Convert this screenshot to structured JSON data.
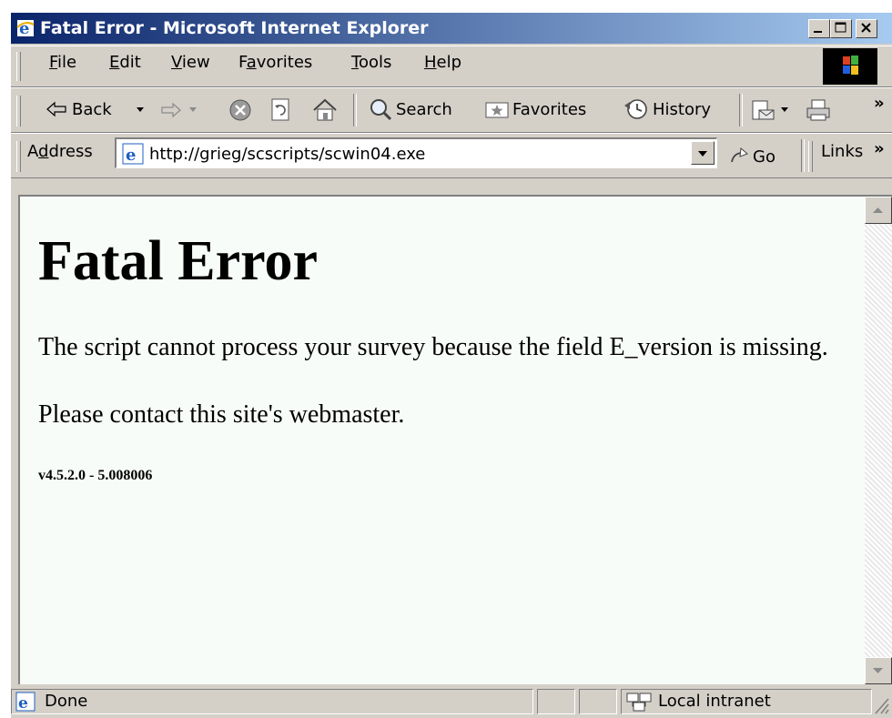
{
  "window": {
    "title": "Fatal Error - Microsoft Internet Explorer"
  },
  "menu": {
    "items": [
      {
        "prefix": "",
        "key": "F",
        "rest": "ile"
      },
      {
        "prefix": "",
        "key": "E",
        "rest": "dit"
      },
      {
        "prefix": "",
        "key": "V",
        "rest": "iew"
      },
      {
        "prefix": "F",
        "key": "a",
        "rest": "vorites"
      },
      {
        "prefix": "",
        "key": "T",
        "rest": "ools"
      },
      {
        "prefix": "",
        "key": "H",
        "rest": "elp"
      }
    ]
  },
  "toolbar": {
    "back_label": "Back",
    "search_label": "Search",
    "favorites_label": "Favorites",
    "history_label": "History",
    "more_glyph": "»"
  },
  "address_bar": {
    "label_prefix": "A",
    "label_key": "d",
    "label_rest": "dress",
    "url": "http://grieg/scscripts/scwin04.exe",
    "go_label": "Go",
    "links_label": "Links",
    "more_glyph": "»"
  },
  "page": {
    "heading": "Fatal Error",
    "message": "The script cannot process your survey because the field E_version is missing.",
    "contact": "Please contact this site's webmaster.",
    "version": "v4.5.2.0 - 5.008006"
  },
  "status": {
    "text": "Done",
    "zone": "Local intranet"
  },
  "colors": {
    "title_bar_start": "#0a246a",
    "title_bar_end": "#a6caf0",
    "chrome": "#d4d0c8",
    "content_bg": "#f8fcf8"
  }
}
